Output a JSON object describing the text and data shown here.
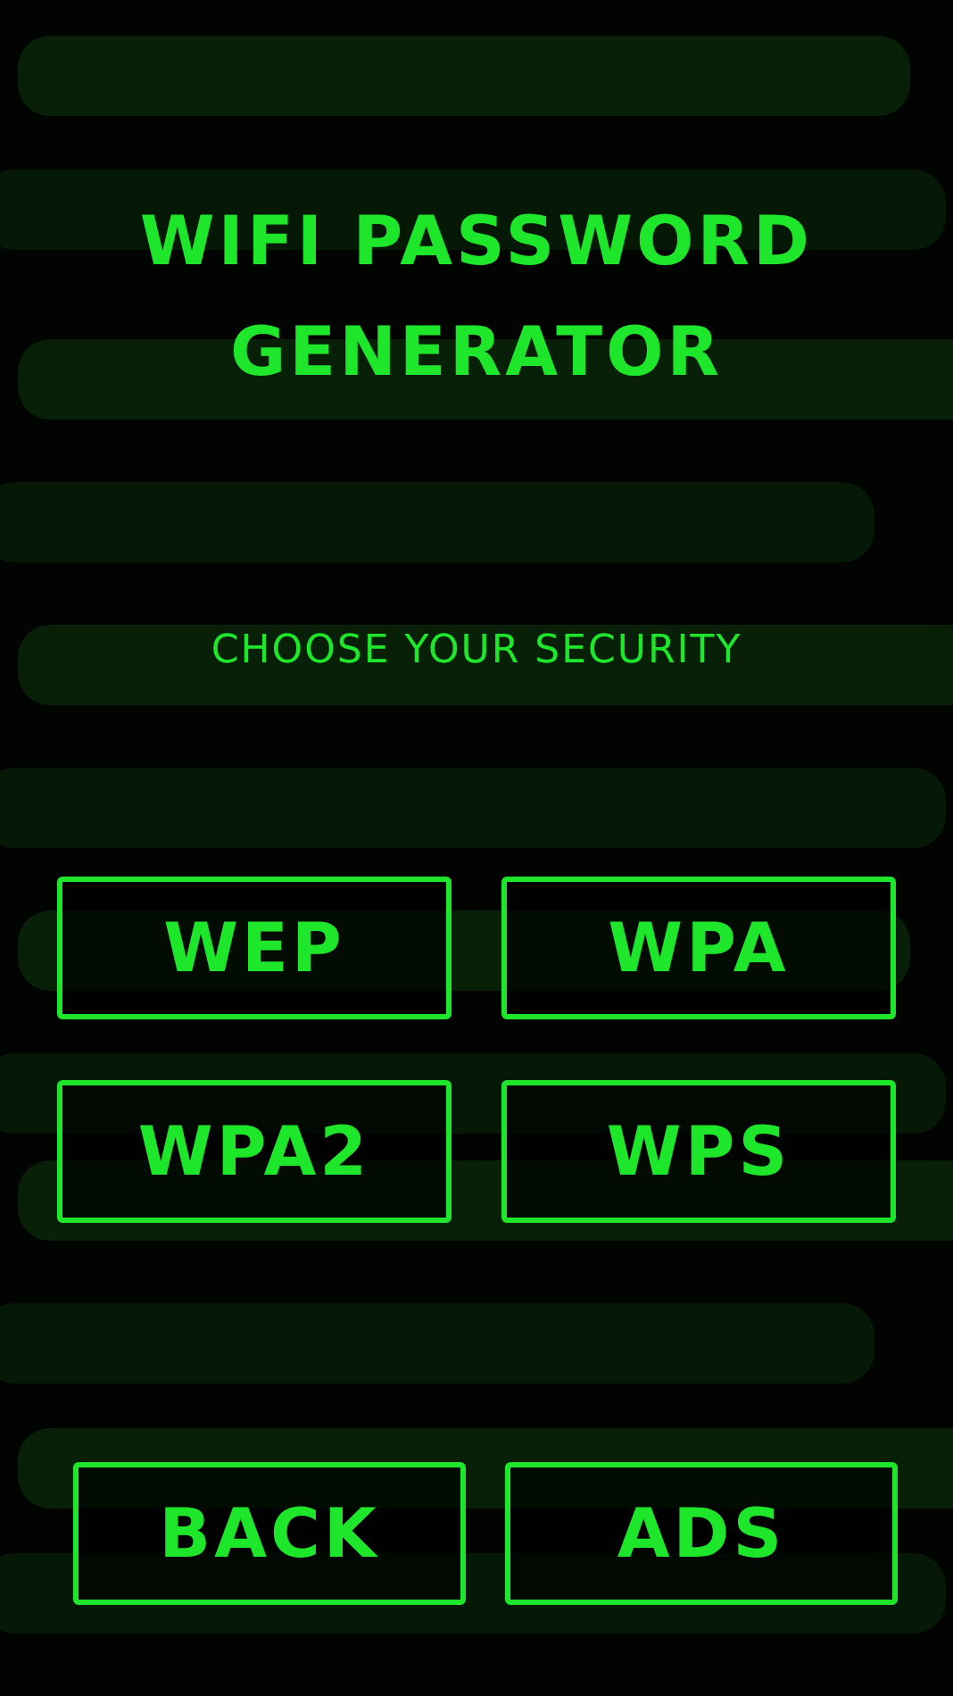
{
  "title": "WIFI PASSWORD GENERATOR",
  "subtitle": "CHOOSE YOUR SECURITY",
  "security_options": [
    "WEP",
    "WPA",
    "WPA2",
    "WPS"
  ],
  "bottom_buttons": [
    "BACK",
    "ADS"
  ]
}
